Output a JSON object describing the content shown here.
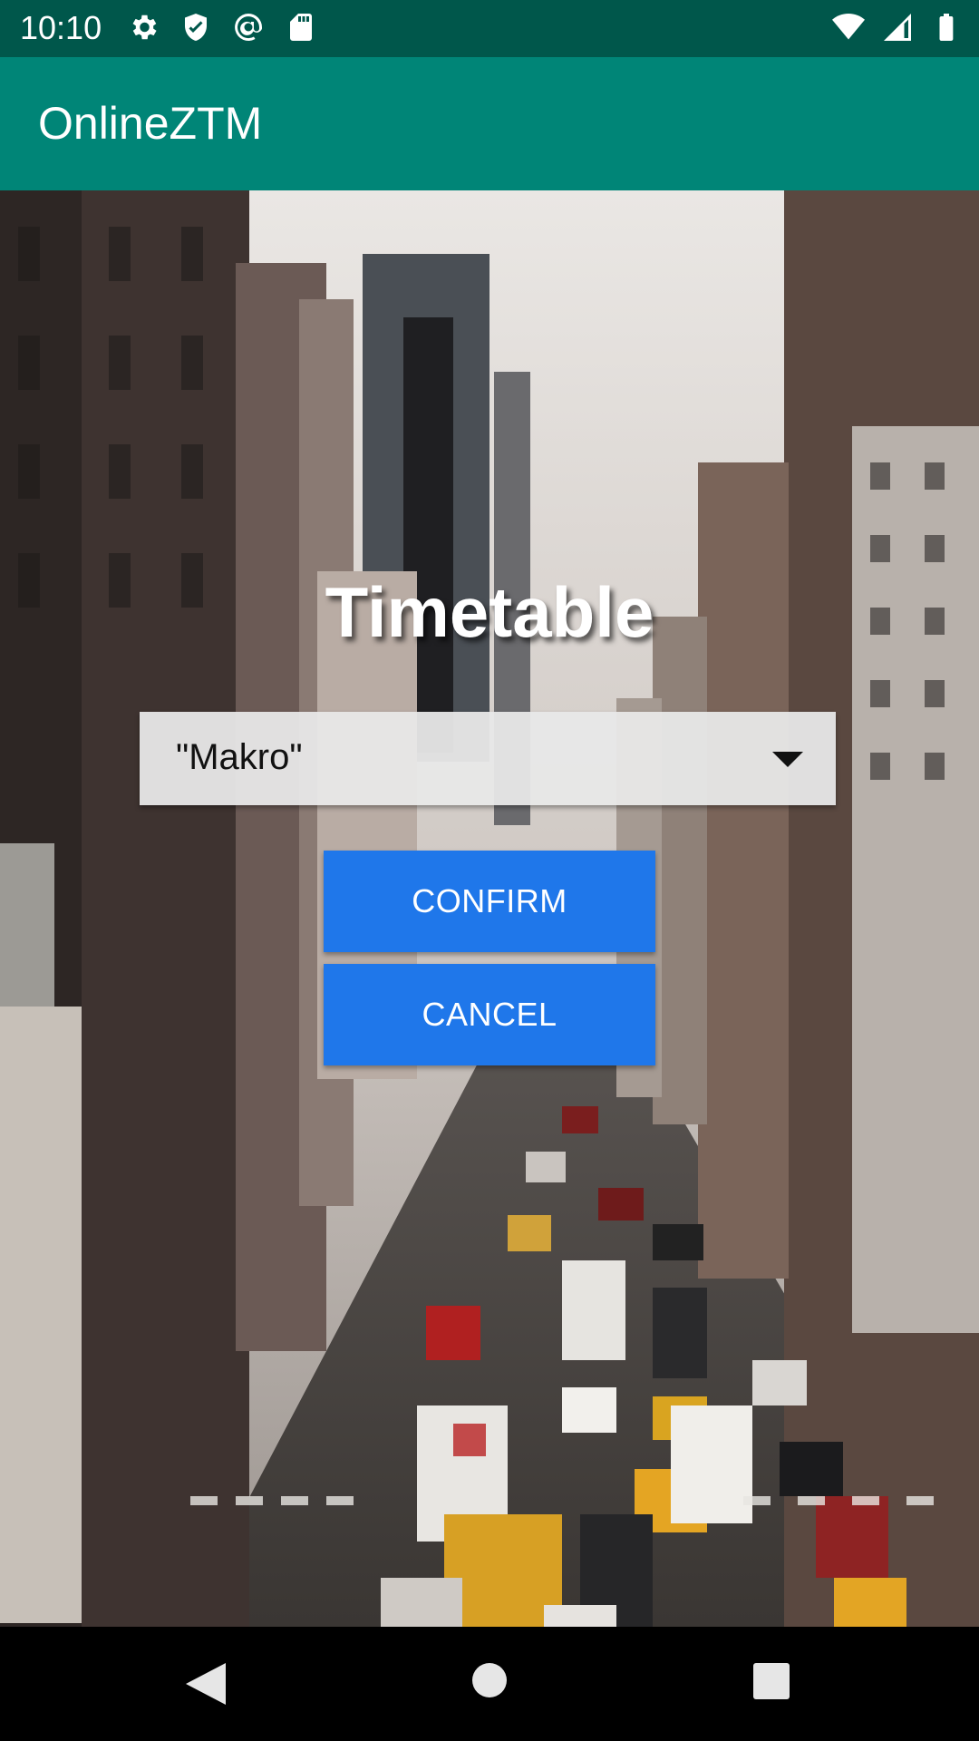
{
  "status_bar": {
    "time": "10:10",
    "icons_left": [
      "gear-icon",
      "shield-icon",
      "at-sign-icon",
      "sd-card-icon"
    ],
    "icons_right": [
      "wifi-icon",
      "signal-icon",
      "battery-icon"
    ]
  },
  "app_bar": {
    "title": "OnlineZTM"
  },
  "main": {
    "heading": "Timetable",
    "stop_select": {
      "value": "\"Makro\""
    },
    "confirm_label": "CONFIRM",
    "cancel_label": "CANCEL"
  },
  "nav_bar": {
    "icons": [
      "back-icon",
      "home-icon",
      "recents-icon"
    ]
  },
  "colors": {
    "status_bar": "#00574B",
    "app_bar": "#008577",
    "button": "#1F77EA",
    "spinner_bg": "#E8E8E8"
  }
}
